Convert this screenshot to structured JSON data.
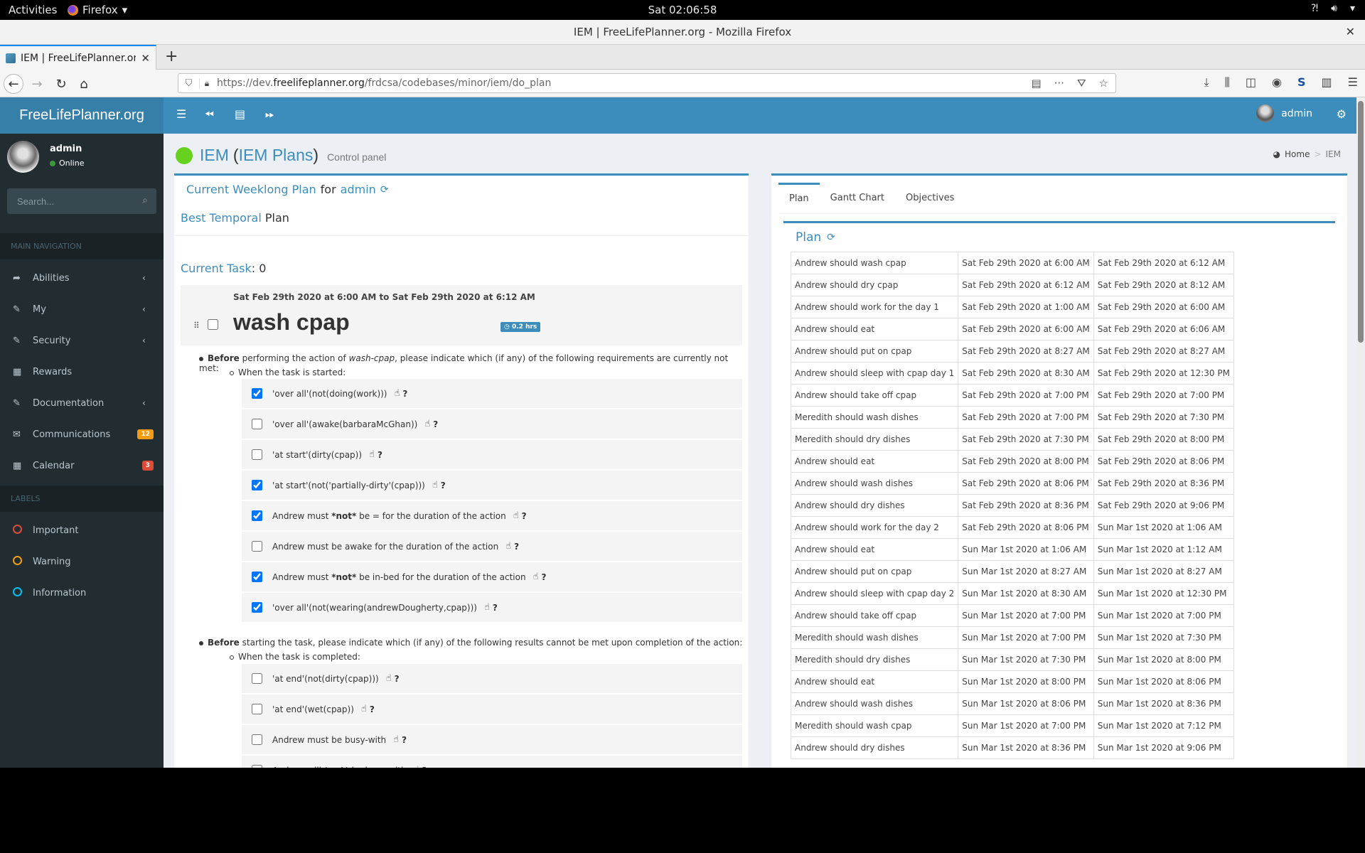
{
  "system_bar": {
    "activities": "Activities",
    "app_menu": "Firefox",
    "clock": "Sat 02:06:58"
  },
  "window": {
    "title": "IEM | FreeLifePlanner.org - Mozilla Firefox"
  },
  "browser": {
    "tab_label": "IEM | FreeLifePlanner.org",
    "url_prefix": "https://dev.",
    "url_domain": "freelifeplanner.org",
    "url_path": "/frdcsa/codebases/minor/iem/do_plan"
  },
  "app": {
    "logo": "FreeLifePlanner.org",
    "header_user": "admin"
  },
  "sidebar": {
    "user_name": "admin",
    "user_status": "Online",
    "search_placeholder": "Search...",
    "main_nav_header": "MAIN NAVIGATION",
    "items": [
      {
        "label": "Abilities",
        "icon": "share-icon",
        "chevron": true
      },
      {
        "label": "My",
        "icon": "edit-icon",
        "chevron": true
      },
      {
        "label": "Security",
        "icon": "edit-icon",
        "chevron": true
      },
      {
        "label": "Rewards",
        "icon": "calendar-icon",
        "chevron": false
      },
      {
        "label": "Documentation",
        "icon": "edit-icon",
        "chevron": true
      },
      {
        "label": "Communications",
        "icon": "envelope-icon",
        "badge": "12",
        "badge_color": "#f39c12"
      },
      {
        "label": "Calendar",
        "icon": "calendar-icon",
        "badge": "3",
        "badge_color": "#dd4b39"
      }
    ],
    "labels_header": "LABELS",
    "labels": [
      {
        "label": "Important",
        "color": "#dd4b39"
      },
      {
        "label": "Warning",
        "color": "#f39c12"
      },
      {
        "label": "Information",
        "color": "#00c0ef"
      }
    ]
  },
  "page": {
    "title_link": "IEM",
    "title_sub_link": "IEM Plans",
    "subtitle": "Control panel",
    "breadcrumb_home": "Home",
    "breadcrumb_current": "IEM"
  },
  "left_panel": {
    "title_link": "Current Weeklong Plan",
    "title_for": "for",
    "title_user": "admin",
    "plan_type_link": "Best Temporal",
    "plan_type_text": "Plan",
    "current_task_label": "Current Task",
    "current_task_value": ": 0",
    "task": {
      "time_range": "Sat Feb 29th 2020 at 6:00 AM to Sat Feb 29th 2020 at 6:12 AM",
      "name": "wash cpap",
      "duration": "0.2 hrs",
      "completed": false
    },
    "before_requirements": {
      "bold": "Before",
      "text_pre": " performing the action of ",
      "action": "wash-cpap",
      "text_post": ", please indicate which (if any) of the following requirements are currently not met:",
      "sub": "When the task is started:",
      "conditions": [
        {
          "pre": "'over all'(not(doing(work)))",
          "bold": "",
          "post": "",
          "checked": true
        },
        {
          "pre": "'over all'(awake(barbaraMcGhan))",
          "bold": "",
          "post": "",
          "checked": false
        },
        {
          "pre": "'at start'(dirty(cpap))",
          "bold": "",
          "post": "",
          "checked": false
        },
        {
          "pre": "'at start'(not('partially-dirty'(cpap)))",
          "bold": "",
          "post": "",
          "checked": true
        },
        {
          "pre": "Andrew must ",
          "bold": "*not*",
          "post": " be = for the duration of the action",
          "checked": true
        },
        {
          "pre": "Andrew must be awake for the duration of the action",
          "bold": "",
          "post": "",
          "checked": false
        },
        {
          "pre": "Andrew must ",
          "bold": "*not*",
          "post": " be in-bed for the duration of the action",
          "checked": true
        },
        {
          "pre": "'over all'(not(wearing(andrewDougherty,cpap)))",
          "bold": "",
          "post": "",
          "checked": true
        }
      ]
    },
    "before_results": {
      "bold": "Before",
      "text": " starting the task, please indicate which (if any) of the following results cannot be met upon completion of the action:",
      "sub": "When the task is completed:",
      "conditions": [
        {
          "pre": "'at end'(not(dirty(cpap)))",
          "bold": "",
          "post": "",
          "checked": false
        },
        {
          "pre": "'at end'(wet(cpap))",
          "bold": "",
          "post": "",
          "checked": false
        },
        {
          "pre": "Andrew must be busy-with",
          "bold": "",
          "post": "",
          "checked": false
        },
        {
          "pre": "Andrew will ",
          "bold": "*not*",
          "post": " be busy-with",
          "checked": false
        }
      ]
    }
  },
  "right_panel": {
    "tabs": [
      "Plan",
      "Gantt Chart",
      "Objectives"
    ],
    "active_tab": "Plan",
    "plan_title": "Plan",
    "plan_rows": [
      [
        "Andrew should wash cpap",
        "Sat Feb 29th 2020 at 6:00 AM",
        "Sat Feb 29th 2020 at 6:12 AM"
      ],
      [
        "Andrew should dry cpap",
        "Sat Feb 29th 2020 at 6:12 AM",
        "Sat Feb 29th 2020 at 8:12 AM"
      ],
      [
        "Andrew should work for the day 1",
        "Sat Feb 29th 2020 at 1:00 AM",
        "Sat Feb 29th 2020 at 6:00 AM"
      ],
      [
        "Andrew should eat",
        "Sat Feb 29th 2020 at 6:00 AM",
        "Sat Feb 29th 2020 at 6:06 AM"
      ],
      [
        "Andrew should put on cpap",
        "Sat Feb 29th 2020 at 8:27 AM",
        "Sat Feb 29th 2020 at 8:27 AM"
      ],
      [
        "Andrew should sleep with cpap day 1",
        "Sat Feb 29th 2020 at 8:30 AM",
        "Sat Feb 29th 2020 at 12:30 PM"
      ],
      [
        "Andrew should take off cpap",
        "Sat Feb 29th 2020 at 7:00 PM",
        "Sat Feb 29th 2020 at 7:00 PM"
      ],
      [
        "Meredith should wash dishes",
        "Sat Feb 29th 2020 at 7:00 PM",
        "Sat Feb 29th 2020 at 7:30 PM"
      ],
      [
        "Meredith should dry dishes",
        "Sat Feb 29th 2020 at 7:30 PM",
        "Sat Feb 29th 2020 at 8:00 PM"
      ],
      [
        "Andrew should eat",
        "Sat Feb 29th 2020 at 8:00 PM",
        "Sat Feb 29th 2020 at 8:06 PM"
      ],
      [
        "Andrew should wash dishes",
        "Sat Feb 29th 2020 at 8:06 PM",
        "Sat Feb 29th 2020 at 8:36 PM"
      ],
      [
        "Andrew should dry dishes",
        "Sat Feb 29th 2020 at 8:36 PM",
        "Sat Feb 29th 2020 at 9:06 PM"
      ],
      [
        "Andrew should work for the day 2",
        "Sat Feb 29th 2020 at 8:06 PM",
        "Sun Mar 1st 2020 at 1:06 AM"
      ],
      [
        "Andrew should eat",
        "Sun Mar 1st 2020 at 1:06 AM",
        "Sun Mar 1st 2020 at 1:12 AM"
      ],
      [
        "Andrew should put on cpap",
        "Sun Mar 1st 2020 at 8:27 AM",
        "Sun Mar 1st 2020 at 8:27 AM"
      ],
      [
        "Andrew should sleep with cpap day 2",
        "Sun Mar 1st 2020 at 8:30 AM",
        "Sun Mar 1st 2020 at 12:30 PM"
      ],
      [
        "Andrew should take off cpap",
        "Sun Mar 1st 2020 at 7:00 PM",
        "Sun Mar 1st 2020 at 7:00 PM"
      ],
      [
        "Meredith should wash dishes",
        "Sun Mar 1st 2020 at 7:00 PM",
        "Sun Mar 1st 2020 at 7:30 PM"
      ],
      [
        "Meredith should dry dishes",
        "Sun Mar 1st 2020 at 7:30 PM",
        "Sun Mar 1st 2020 at 8:00 PM"
      ],
      [
        "Andrew should eat",
        "Sun Mar 1st 2020 at 8:00 PM",
        "Sun Mar 1st 2020 at 8:06 PM"
      ],
      [
        "Andrew should wash dishes",
        "Sun Mar 1st 2020 at 8:06 PM",
        "Sun Mar 1st 2020 at 8:36 PM"
      ],
      [
        "Meredith should wash cpap",
        "Sun Mar 1st 2020 at 7:00 PM",
        "Sun Mar 1st 2020 at 7:12 PM"
      ],
      [
        "Andrew should dry dishes",
        "Sun Mar 1st 2020 at 8:36 PM",
        "Sun Mar 1st 2020 at 9:06 PM"
      ]
    ]
  }
}
